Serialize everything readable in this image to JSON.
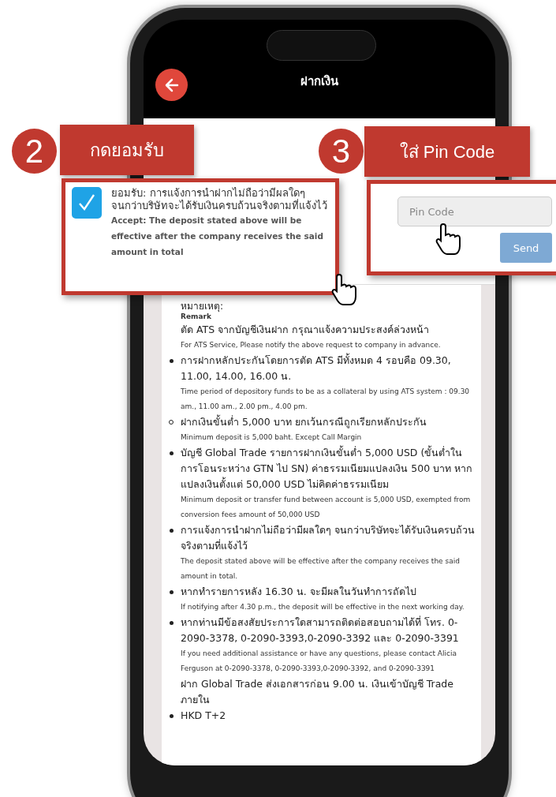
{
  "header": {
    "title": "ฝากเงิน"
  },
  "notes": [
    {
      "kind": "heading",
      "thai": "หมายเหตุ:",
      "english": "Remark"
    },
    {
      "kind": "plain",
      "thai": "ตัด ATS จากบัญชีเงินฝาก กรุณาแจ้งความประสงค์ล่วงหน้า",
      "english": "For ATS Service, Please notify the above request to company in advance."
    },
    {
      "kind": "bullet",
      "thai": "การฝากหลักประกันโดยการตัด ATS มีทั้งหมด 4 รอบคือ 09.30, 11.00, 14.00, 16.00 น.",
      "english": "Time period of depository funds to be as a collateral by using ATS system : 09.30 am., 11.00 am., 2.00 pm., 4.00 pm."
    },
    {
      "kind": "circle",
      "thai": "ฝากเงินขั้นต่ำ 5,000 บาท ยกเว้นกรณีถูกเรียกหลักประกัน",
      "english": "Minimum deposit is 5,000 baht. Except Call Margin"
    },
    {
      "kind": "bullet",
      "thai": "บัญชี Global Trade รายการฝากเงินขั้นต่ำ 5,000 USD (ขั้นต่ำในการโอนระหว่าง GTN ไป SN) ค่าธรรมเนียมแปลงเงิน 500 บาท หากแปลงเงินตั้งแต่ 50,000 USD ไม่คิดค่าธรรมเนียม",
      "english": "Minimum deposit or transfer fund between account is 5,000 USD, exempted from conversion fees amount of 50,000 USD"
    },
    {
      "kind": "bullet",
      "thai": "การแจ้งการนำฝากไม่ถือว่ามีผลใดๆ จนกว่าบริษัทจะได้รับเงินครบถ้วนจริงตามที่แจ้งไว้",
      "english": "The deposit stated above will be effective after the company receives the said amount in total."
    },
    {
      "kind": "bullet",
      "thai": "หากทำรายการหลัง 16.30 น. จะมีผลในวันทำการถัดไป",
      "english": "If notifying after 4.30 p.m., the deposit will be effective in the next working day."
    },
    {
      "kind": "bullet",
      "thai": "หากท่านมีข้อสงสัยประการใดสามารถติดต่อสอบถามได้ที่ โทร. 0-2090-3378, 0-2090-3393,0-2090-3392 และ 0-2090-3391",
      "english": "If you need additional assistance or have any questions, please contact Alicia Ferguson at 0-2090-3378, 0-2090-3393,0-2090-3392, and 0-2090-3391"
    },
    {
      "kind": "plain",
      "thai": "ฝาก Global Trade ส่งเอกสารก่อน 9.00 น. เงินเข้าบัญชี Trade ภายใน"
    },
    {
      "kind": "bullet",
      "thai": "HKD T+2"
    }
  ],
  "callouts": [
    {
      "number": "2",
      "label": "กดยอมรับ"
    },
    {
      "number": "3",
      "label": "ใส่ Pin Code"
    }
  ],
  "accept": {
    "checked": true,
    "thai": "ยอมรับ: การแจ้งการนำฝากไม่ถือว่ามีผลใดๆ จนกว่าบริษัทจะได้รับเงินครบถ้วนจริงตามที่แจ้งไว้",
    "english": "Accept: The deposit stated above will be effective after the company receives the said amount in total"
  },
  "pin": {
    "placeholder": "Pin Code",
    "button": "Send"
  }
}
